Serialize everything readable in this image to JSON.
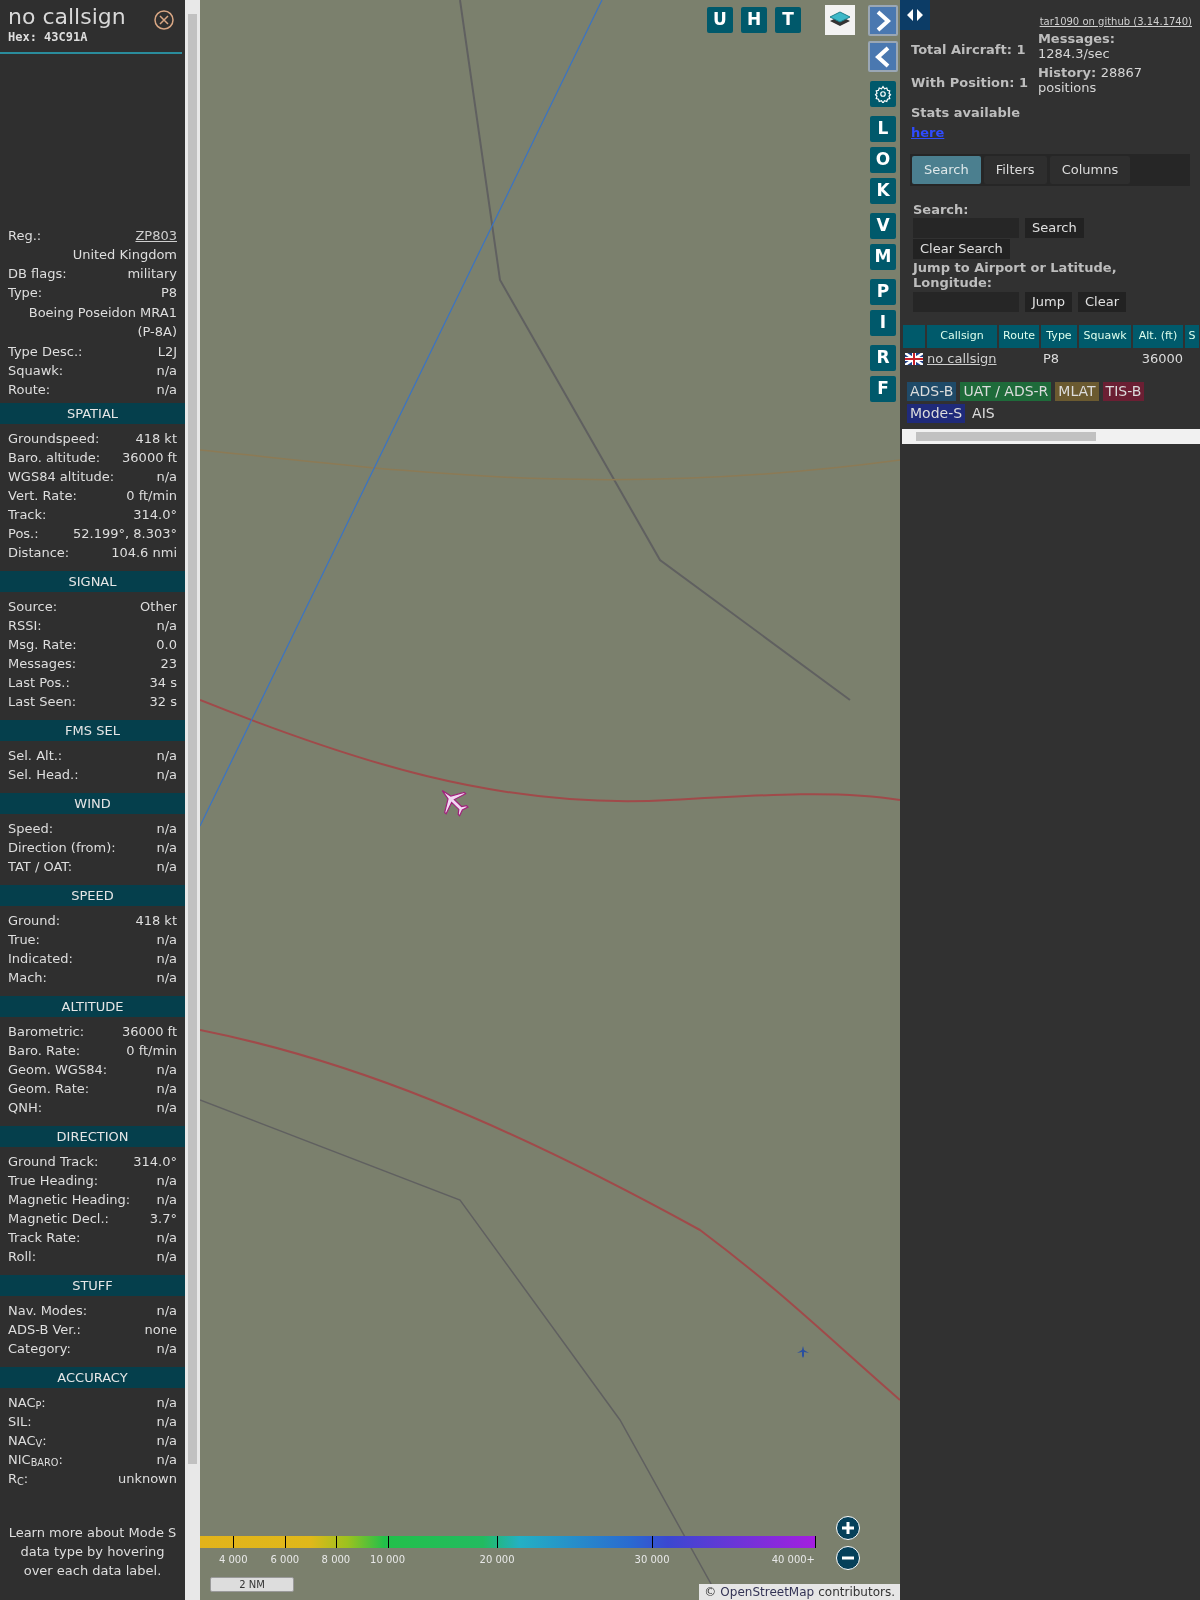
{
  "sidebar": {
    "title": "no callsign",
    "hex": "Hex: 43C91A",
    "info_rows": [
      {
        "kind": "link",
        "label": "Reg.:",
        "value": "ZP803"
      },
      {
        "kind": "value",
        "value": "United Kingdom"
      },
      {
        "kind": "pair",
        "label": "DB flags:",
        "value": "military"
      },
      {
        "kind": "pair",
        "label": "Type:",
        "value": "P8"
      },
      {
        "kind": "wide",
        "value": "Boeing Poseidon MRA1 (P-8A)"
      },
      {
        "kind": "pair",
        "label": "Type Desc.:",
        "value": "L2J"
      },
      {
        "kind": "pair",
        "label": "Squawk:",
        "value": "n/a"
      },
      {
        "kind": "pair",
        "label": "Route:",
        "value": "n/a"
      }
    ],
    "sections": [
      {
        "title": "SPATIAL",
        "rows": [
          {
            "label": "Groundspeed:",
            "value": "418 kt"
          },
          {
            "label": "Baro. altitude:",
            "value": "36000 ft"
          },
          {
            "label": "WGS84 altitude:",
            "value": "n/a"
          },
          {
            "label": "Vert. Rate:",
            "value": "0 ft/min"
          },
          {
            "label": "Track:",
            "value": "314.0°"
          },
          {
            "label": "Pos.:",
            "value": "52.199°, 8.303°"
          },
          {
            "label": "Distance:",
            "value": "104.6 nmi"
          }
        ]
      },
      {
        "title": "SIGNAL",
        "rows": [
          {
            "label": "Source:",
            "value": "Other"
          },
          {
            "label": "RSSI:",
            "value": "n/a"
          },
          {
            "label": "Msg. Rate:",
            "value": "0.0"
          },
          {
            "label": "Messages:",
            "value": "23"
          },
          {
            "label": "Last Pos.:",
            "value": "34 s"
          },
          {
            "label": "Last Seen:",
            "value": "32 s"
          }
        ]
      },
      {
        "title": "FMS SEL",
        "rows": [
          {
            "label": "Sel. Alt.:",
            "value": "n/a"
          },
          {
            "label": "Sel. Head.:",
            "value": "n/a"
          }
        ]
      },
      {
        "title": "WIND",
        "rows": [
          {
            "label": "Speed:",
            "value": "n/a"
          },
          {
            "label": "Direction (from):",
            "value": "n/a"
          },
          {
            "label": "TAT / OAT:",
            "value": "n/a"
          }
        ]
      },
      {
        "title": "SPEED",
        "rows": [
          {
            "label": "Ground:",
            "value": "418 kt"
          },
          {
            "label": "True:",
            "value": "n/a"
          },
          {
            "label": "Indicated:",
            "value": "n/a"
          },
          {
            "label": "Mach:",
            "value": "n/a"
          }
        ]
      },
      {
        "title": "ALTITUDE",
        "rows": [
          {
            "label": "Barometric:",
            "value": "36000 ft"
          },
          {
            "label": "Baro. Rate:",
            "value": "0 ft/min"
          },
          {
            "label": "Geom. WGS84:",
            "value": "n/a"
          },
          {
            "label": "Geom. Rate:",
            "value": "n/a"
          },
          {
            "label": "QNH:",
            "value": "n/a"
          }
        ]
      },
      {
        "title": "DIRECTION",
        "rows": [
          {
            "label": "Ground Track:",
            "value": "314.0°"
          },
          {
            "label": "True Heading:",
            "value": "n/a"
          },
          {
            "label": "Magnetic Heading:",
            "value": "n/a"
          },
          {
            "label": "Magnetic Decl.:",
            "value": "3.7°"
          },
          {
            "label": "Track Rate:",
            "value": "n/a"
          },
          {
            "label": "Roll:",
            "value": "n/a"
          }
        ]
      },
      {
        "title": "STUFF",
        "rows": [
          {
            "label": "Nav. Modes:",
            "value": "n/a"
          },
          {
            "label": "ADS-B Ver.:",
            "value": "none"
          },
          {
            "label": "Category:",
            "value": "n/a"
          }
        ]
      },
      {
        "title": "ACCURACY",
        "rows": [
          {
            "label": "NAC$_{P}$:",
            "value": "n/a"
          },
          {
            "label": "SIL:",
            "value": "n/a"
          },
          {
            "label": "NAC$_{V}$:",
            "value": "n/a"
          },
          {
            "label": "NIC$_{BARO}$:",
            "value": "n/a"
          },
          {
            "label": "R$_{C}$:",
            "value": "unknown"
          }
        ]
      }
    ],
    "note": "Learn more about Mode S data type by hovering over each data label."
  },
  "map": {
    "top_buttons": [
      {
        "kind": "letter",
        "label": "U"
      },
      {
        "kind": "letter",
        "label": "H"
      },
      {
        "kind": "letter",
        "label": "T"
      },
      {
        "kind": "layers"
      }
    ],
    "side_groups": [
      [
        {
          "kind": "arrow_right"
        },
        {
          "kind": "arrow_left"
        }
      ],
      [
        {
          "kind": "gear"
        }
      ],
      [
        {
          "kind": "letter",
          "label": "L"
        },
        {
          "kind": "letter",
          "label": "O"
        },
        {
          "kind": "letter",
          "label": "K"
        }
      ],
      [
        {
          "kind": "letter",
          "label": "V"
        },
        {
          "kind": "letter",
          "label": "M"
        }
      ],
      [
        {
          "kind": "letter",
          "label": "P"
        },
        {
          "kind": "letter",
          "label": "I"
        }
      ],
      [
        {
          "kind": "letter",
          "label": "R"
        },
        {
          "kind": "letter",
          "label": "F"
        }
      ]
    ],
    "altitude_legend": [
      "4 000",
      "6 000",
      "8 000",
      "10 000",
      "20 000",
      "30 000",
      "40 000+"
    ],
    "scale": "2 NM",
    "attribution": {
      "prefix": "©",
      "link": "OpenStreetMap",
      "suffix": "contributors."
    }
  },
  "panel": {
    "version_link": "tar1090 on github (3.14.1740)",
    "stats_left": [
      "Total Aircraft: 1",
      "With Position: 1"
    ],
    "stats_link_label": "Stats available",
    "stats_link": "here",
    "stats_right": [
      {
        "label": "Messages:",
        "value": "1284.3/sec"
      },
      {
        "label": "History:",
        "value": "28867 positions"
      }
    ],
    "tabs": [
      {
        "label": "Search",
        "selected": true
      },
      {
        "label": "Filters",
        "selected": false
      },
      {
        "label": "Columns",
        "selected": false
      }
    ],
    "search_label": "Search:",
    "search_button": "Search",
    "clear_search_button": "Clear Search",
    "jump_label": "Jump to Airport or Latitude, Longitude:",
    "jump_button": "Jump",
    "clear_button": "Clear",
    "table": {
      "columns": [
        "",
        "Callsign",
        "Route",
        "Type",
        "Squawk",
        "Alt. (ft)",
        "S"
      ],
      "rows": [
        {
          "callsign": "no callsign",
          "route": "",
          "type": "P8",
          "squawk": "",
          "altitude": "36000"
        }
      ]
    },
    "sources": [
      {
        "label": "ADS-B",
        "color": "#1f4a68"
      },
      {
        "label": "UAT / ADS-R",
        "color": "#1e6b3a"
      },
      {
        "label": "MLAT",
        "color": "#6b5a30"
      },
      {
        "label": "TIS-B",
        "color": "#6b1f33"
      },
      {
        "label": "Mode-S",
        "color": "#1f2a7a"
      },
      {
        "label": "AIS",
        "color": "#313131"
      }
    ]
  }
}
